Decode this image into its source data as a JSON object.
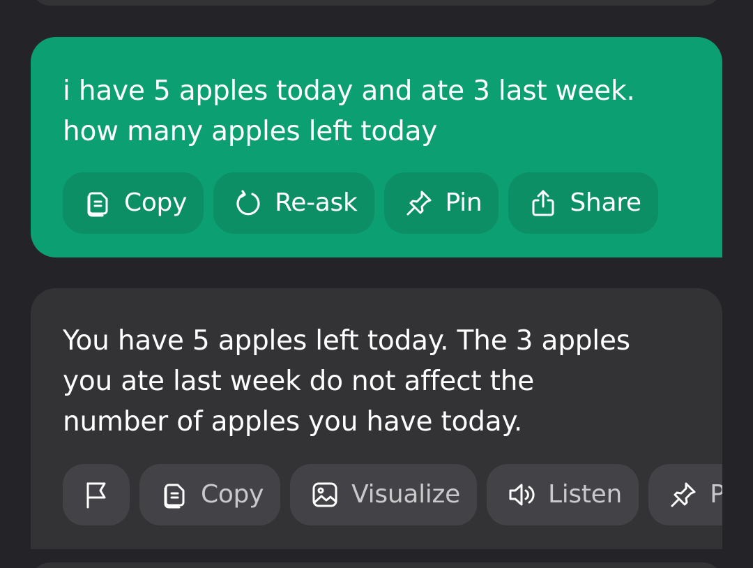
{
  "user_message": {
    "text": "i have 5 apples today and ate 3 last week.\nhow many apples left today",
    "actions": [
      {
        "label": "Copy",
        "icon": "copy-icon"
      },
      {
        "label": "Re-ask",
        "icon": "refresh-icon"
      },
      {
        "label": "Pin",
        "icon": "pin-icon"
      },
      {
        "label": "Share",
        "icon": "share-icon"
      }
    ]
  },
  "assistant_message": {
    "text": "You have 5 apples left today. The 3 apples\nyou ate last week do not affect the\nnumber of apples you have today.",
    "actions": [
      {
        "label": "",
        "icon": "flag-icon"
      },
      {
        "label": "Copy",
        "icon": "copy-icon"
      },
      {
        "label": "Visualize",
        "icon": "image-icon"
      },
      {
        "label": "Listen",
        "icon": "speaker-icon"
      },
      {
        "label": "P",
        "icon": "pin-icon"
      }
    ]
  },
  "colors": {
    "background": "#242428",
    "user_bubble": "#0c9f71",
    "user_chip": "#0d8f66",
    "assistant_bubble": "#333336",
    "assistant_chip": "#434347"
  }
}
